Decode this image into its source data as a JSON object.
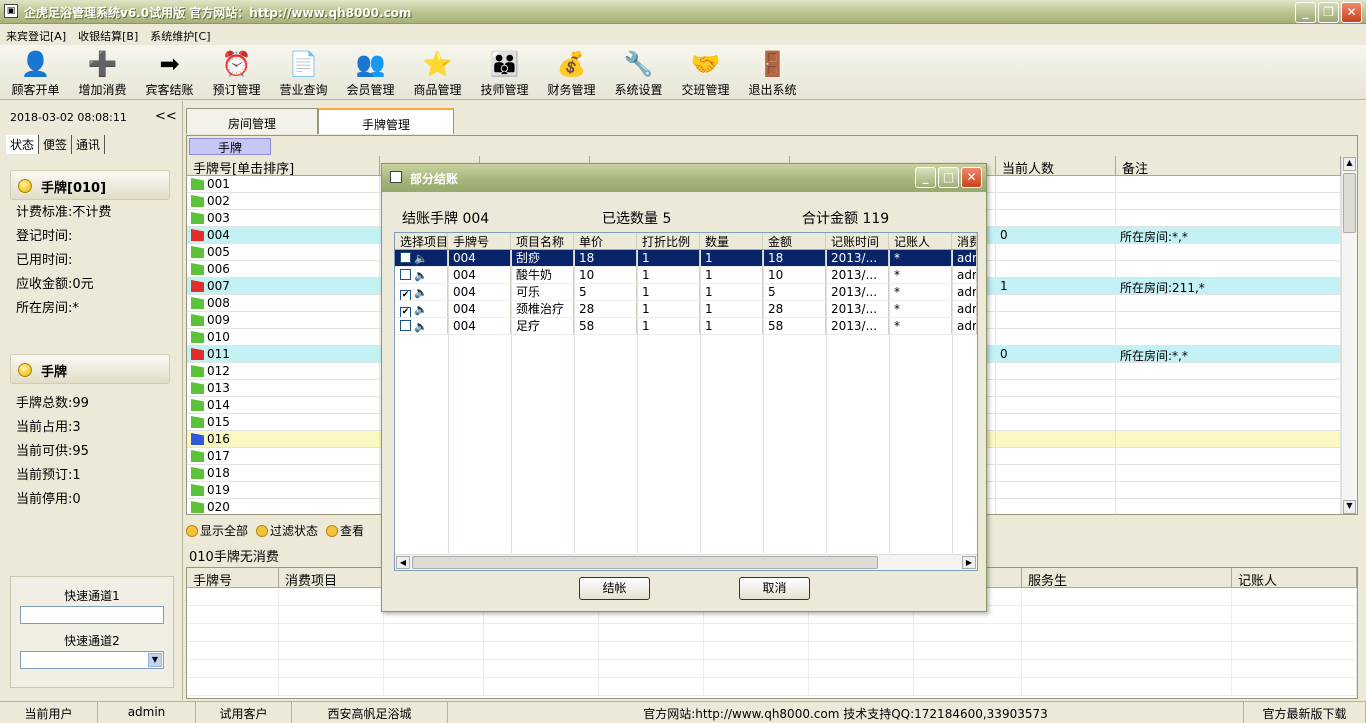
{
  "window": {
    "title": "企虎足浴管理系统v6.0试用版  官方网站：http://www.qh8000.com"
  },
  "menu": [
    "来宾登记[A]",
    "收银结算[B]",
    "系统维护[C]"
  ],
  "toolbar": [
    {
      "label": "顾客开单",
      "icon": "customer-icon",
      "glyph": "👤"
    },
    {
      "label": "增加消费",
      "icon": "add-consumption-icon",
      "glyph": "➕"
    },
    {
      "label": "宾客结账",
      "icon": "checkout-icon",
      "glyph": "➡"
    },
    {
      "label": "预订管理",
      "icon": "clock-icon",
      "glyph": "⏰"
    },
    {
      "label": "营业查询",
      "icon": "query-icon",
      "glyph": "📄"
    },
    {
      "label": "会员管理",
      "icon": "members-icon",
      "glyph": "👥"
    },
    {
      "label": "商品管理",
      "icon": "star-icon",
      "glyph": "⭐"
    },
    {
      "label": "技师管理",
      "icon": "technician-icon",
      "glyph": "👪"
    },
    {
      "label": "财务管理",
      "icon": "finance-icon",
      "glyph": "💰"
    },
    {
      "label": "系统设置",
      "icon": "settings-icon",
      "glyph": "🔧"
    },
    {
      "label": "交班管理",
      "icon": "handshake-icon",
      "glyph": "🤝"
    },
    {
      "label": "退出系统",
      "icon": "exit-icon",
      "glyph": "🚪"
    }
  ],
  "left": {
    "datetime": "2018-03-02 08:08:11",
    "collapse": "<<",
    "tabs": [
      "状态",
      "便签",
      "通讯"
    ],
    "card": {
      "title": "手牌[010]",
      "lines": [
        "计费标准:不计费",
        "登记时间:",
        "已用时间:",
        "应收金额:0元",
        "所在房间:*"
      ]
    },
    "summary": {
      "title": "手牌",
      "lines": [
        "手牌总数:99",
        "当前占用:3",
        "当前可供:95",
        "当前预订:1",
        "当前停用:0"
      ]
    },
    "quick1_label": "快速通道1",
    "quick2_label": "快速通道2"
  },
  "main": {
    "tabs": [
      "房间管理",
      "手牌管理"
    ],
    "tag": "手牌",
    "columns": [
      "手牌号[单击排序]",
      "",
      "",
      "",
      "",
      "当前人数",
      "备注"
    ],
    "rows": [
      {
        "no": "001",
        "flag": "g",
        "count": "",
        "note": "",
        "hl": ""
      },
      {
        "no": "002",
        "flag": "g",
        "count": "",
        "note": "",
        "hl": ""
      },
      {
        "no": "003",
        "flag": "g",
        "count": "",
        "note": "",
        "hl": ""
      },
      {
        "no": "004",
        "flag": "r",
        "count": "0",
        "note": "所在房间:*,*",
        "hl": "cyan"
      },
      {
        "no": "005",
        "flag": "g",
        "count": "",
        "note": "",
        "hl": ""
      },
      {
        "no": "006",
        "flag": "g",
        "count": "",
        "note": "",
        "hl": ""
      },
      {
        "no": "007",
        "flag": "r",
        "count": "1",
        "note": "所在房间:211,*",
        "hl": "cyan"
      },
      {
        "no": "008",
        "flag": "g",
        "count": "",
        "note": "",
        "hl": ""
      },
      {
        "no": "009",
        "flag": "g",
        "count": "",
        "note": "",
        "hl": ""
      },
      {
        "no": "010",
        "flag": "g",
        "count": "",
        "note": "",
        "hl": ""
      },
      {
        "no": "011",
        "flag": "r",
        "count": "0",
        "note": "所在房间:*,*",
        "hl": "cyan"
      },
      {
        "no": "012",
        "flag": "g",
        "count": "",
        "note": "",
        "hl": ""
      },
      {
        "no": "013",
        "flag": "g",
        "count": "",
        "note": "",
        "hl": ""
      },
      {
        "no": "014",
        "flag": "g",
        "count": "",
        "note": "",
        "hl": ""
      },
      {
        "no": "015",
        "flag": "g",
        "count": "",
        "note": "",
        "hl": ""
      },
      {
        "no": "016",
        "flag": "b",
        "count": "",
        "note": "",
        "hl": "yellow"
      },
      {
        "no": "017",
        "flag": "g",
        "count": "",
        "note": "",
        "hl": ""
      },
      {
        "no": "018",
        "flag": "g",
        "count": "",
        "note": "",
        "hl": ""
      },
      {
        "no": "019",
        "flag": "g",
        "count": "",
        "note": "",
        "hl": ""
      },
      {
        "no": "020",
        "flag": "g",
        "count": "",
        "note": "",
        "hl": ""
      }
    ],
    "filters": [
      "显示全部",
      "过滤状态",
      "查看"
    ],
    "no_sale": "010手牌无消费",
    "bottom_columns": [
      "手牌号",
      "消费项目",
      "",
      "",
      "",
      "",
      "",
      "",
      "服务生",
      "记账人"
    ]
  },
  "dialog": {
    "title": "部分结账",
    "tag_label": "结账手牌 004",
    "count_label": "已选数量 5",
    "total_label": "合计金额 119",
    "columns": [
      "选择项目",
      "手牌号",
      "项目名称",
      "单价",
      "打折比例",
      "数量",
      "金额",
      "记账时间",
      "记账人",
      "消费"
    ],
    "rows": [
      {
        "checked": false,
        "no": "004",
        "item": "刮痧",
        "price": "18",
        "disc": "1",
        "qty": "1",
        "amount": "18",
        "time": "2013/...",
        "by": "*",
        "extra": "adr",
        "sel": true
      },
      {
        "checked": false,
        "no": "004",
        "item": "酸牛奶",
        "price": "10",
        "disc": "1",
        "qty": "1",
        "amount": "10",
        "time": "2013/...",
        "by": "*",
        "extra": "adr",
        "sel": false
      },
      {
        "checked": true,
        "no": "004",
        "item": "可乐",
        "price": "5",
        "disc": "1",
        "qty": "1",
        "amount": "5",
        "time": "2013/...",
        "by": "*",
        "extra": "adr",
        "sel": false
      },
      {
        "checked": true,
        "no": "004",
        "item": "颈椎治疗",
        "price": "28",
        "disc": "1",
        "qty": "1",
        "amount": "28",
        "time": "2013/...",
        "by": "*",
        "extra": "adr",
        "sel": false
      },
      {
        "checked": false,
        "no": "004",
        "item": "足疗",
        "price": "58",
        "disc": "1",
        "qty": "1",
        "amount": "58",
        "time": "2013/...",
        "by": "*",
        "extra": "adr",
        "sel": false
      }
    ],
    "ok_label": "结帐",
    "cancel_label": "取消"
  },
  "status": {
    "user_label": "当前用户",
    "user": "admin",
    "client_type": "试用客户",
    "client_name": "西安高帆足浴城",
    "site": "官方网站:http://www.qh8000.com 技术支持QQ:172184600,33903573",
    "download": "官方最新版下载"
  }
}
